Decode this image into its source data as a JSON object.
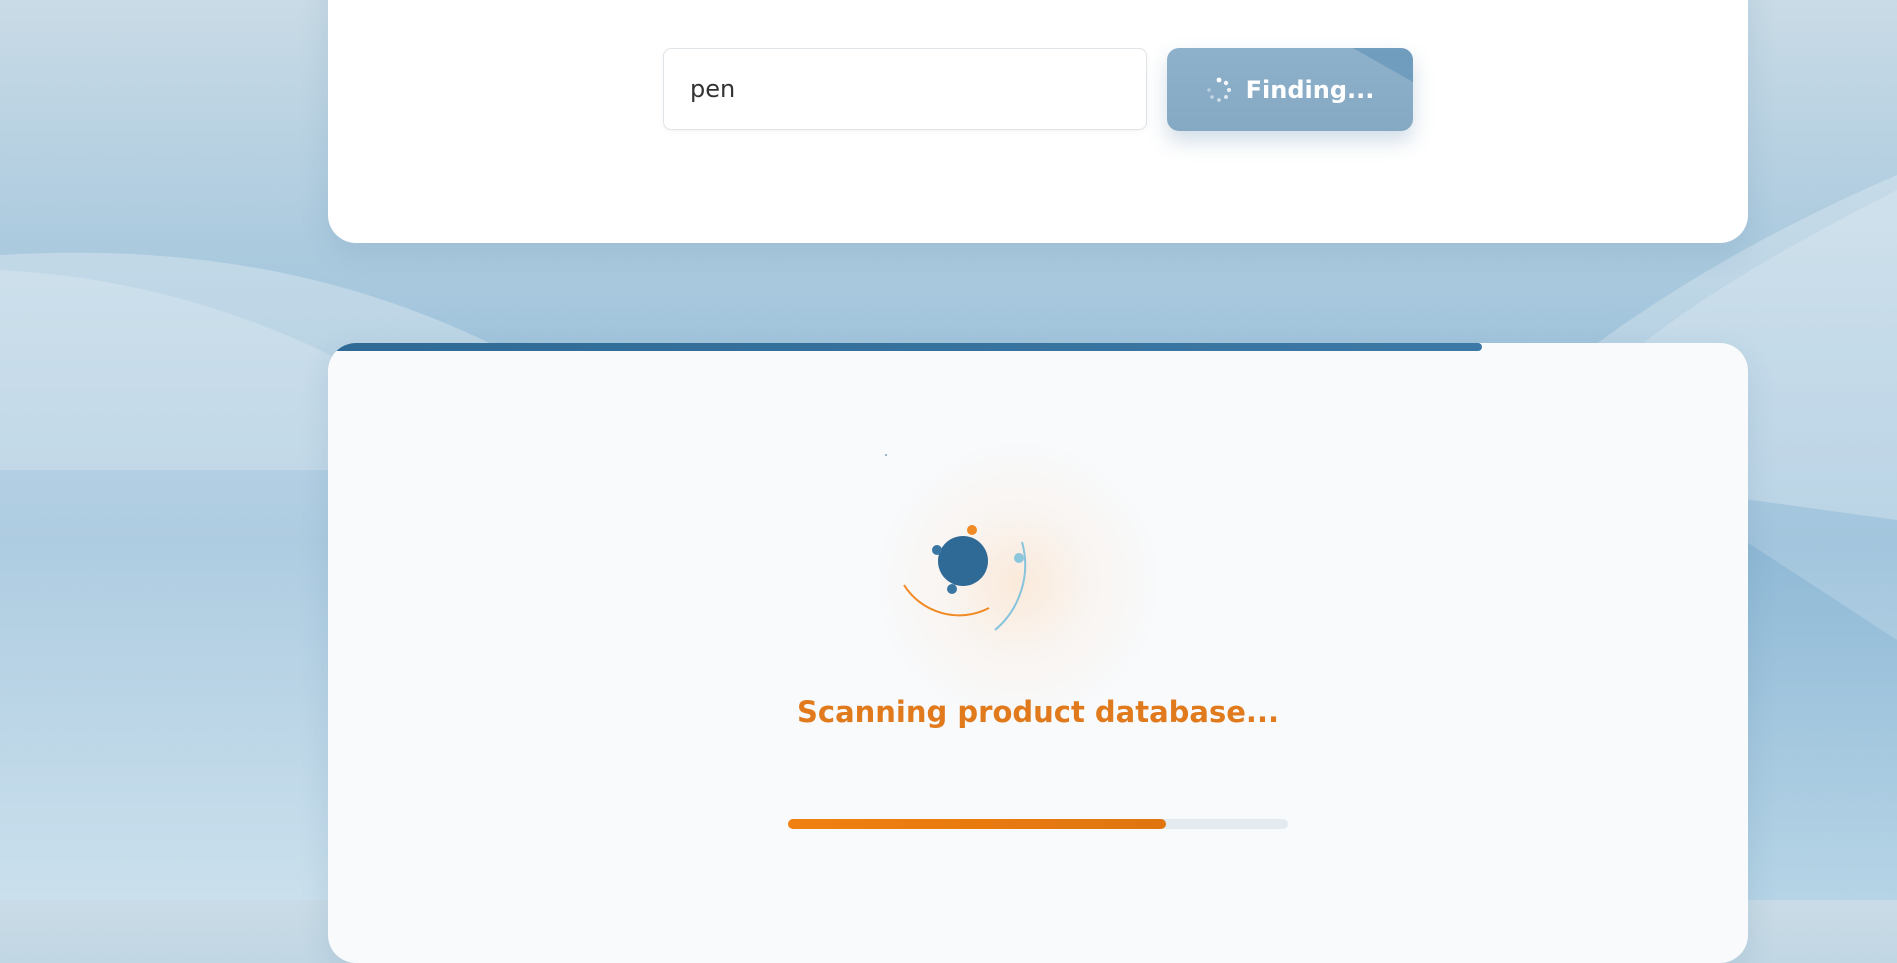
{
  "search": {
    "value": "pen",
    "button_label": "Finding...",
    "button_icon": "spinner-icon"
  },
  "loading": {
    "status_text": "Scanning product database...",
    "progress_fraction": 0.755,
    "top_progress_fraction": 0.813,
    "icon": "orbit-loader-icon"
  },
  "colors": {
    "accent_orange": "#e07a1c",
    "primary_blue": "#2f6a96",
    "button_blue": "#8eb1cb"
  }
}
